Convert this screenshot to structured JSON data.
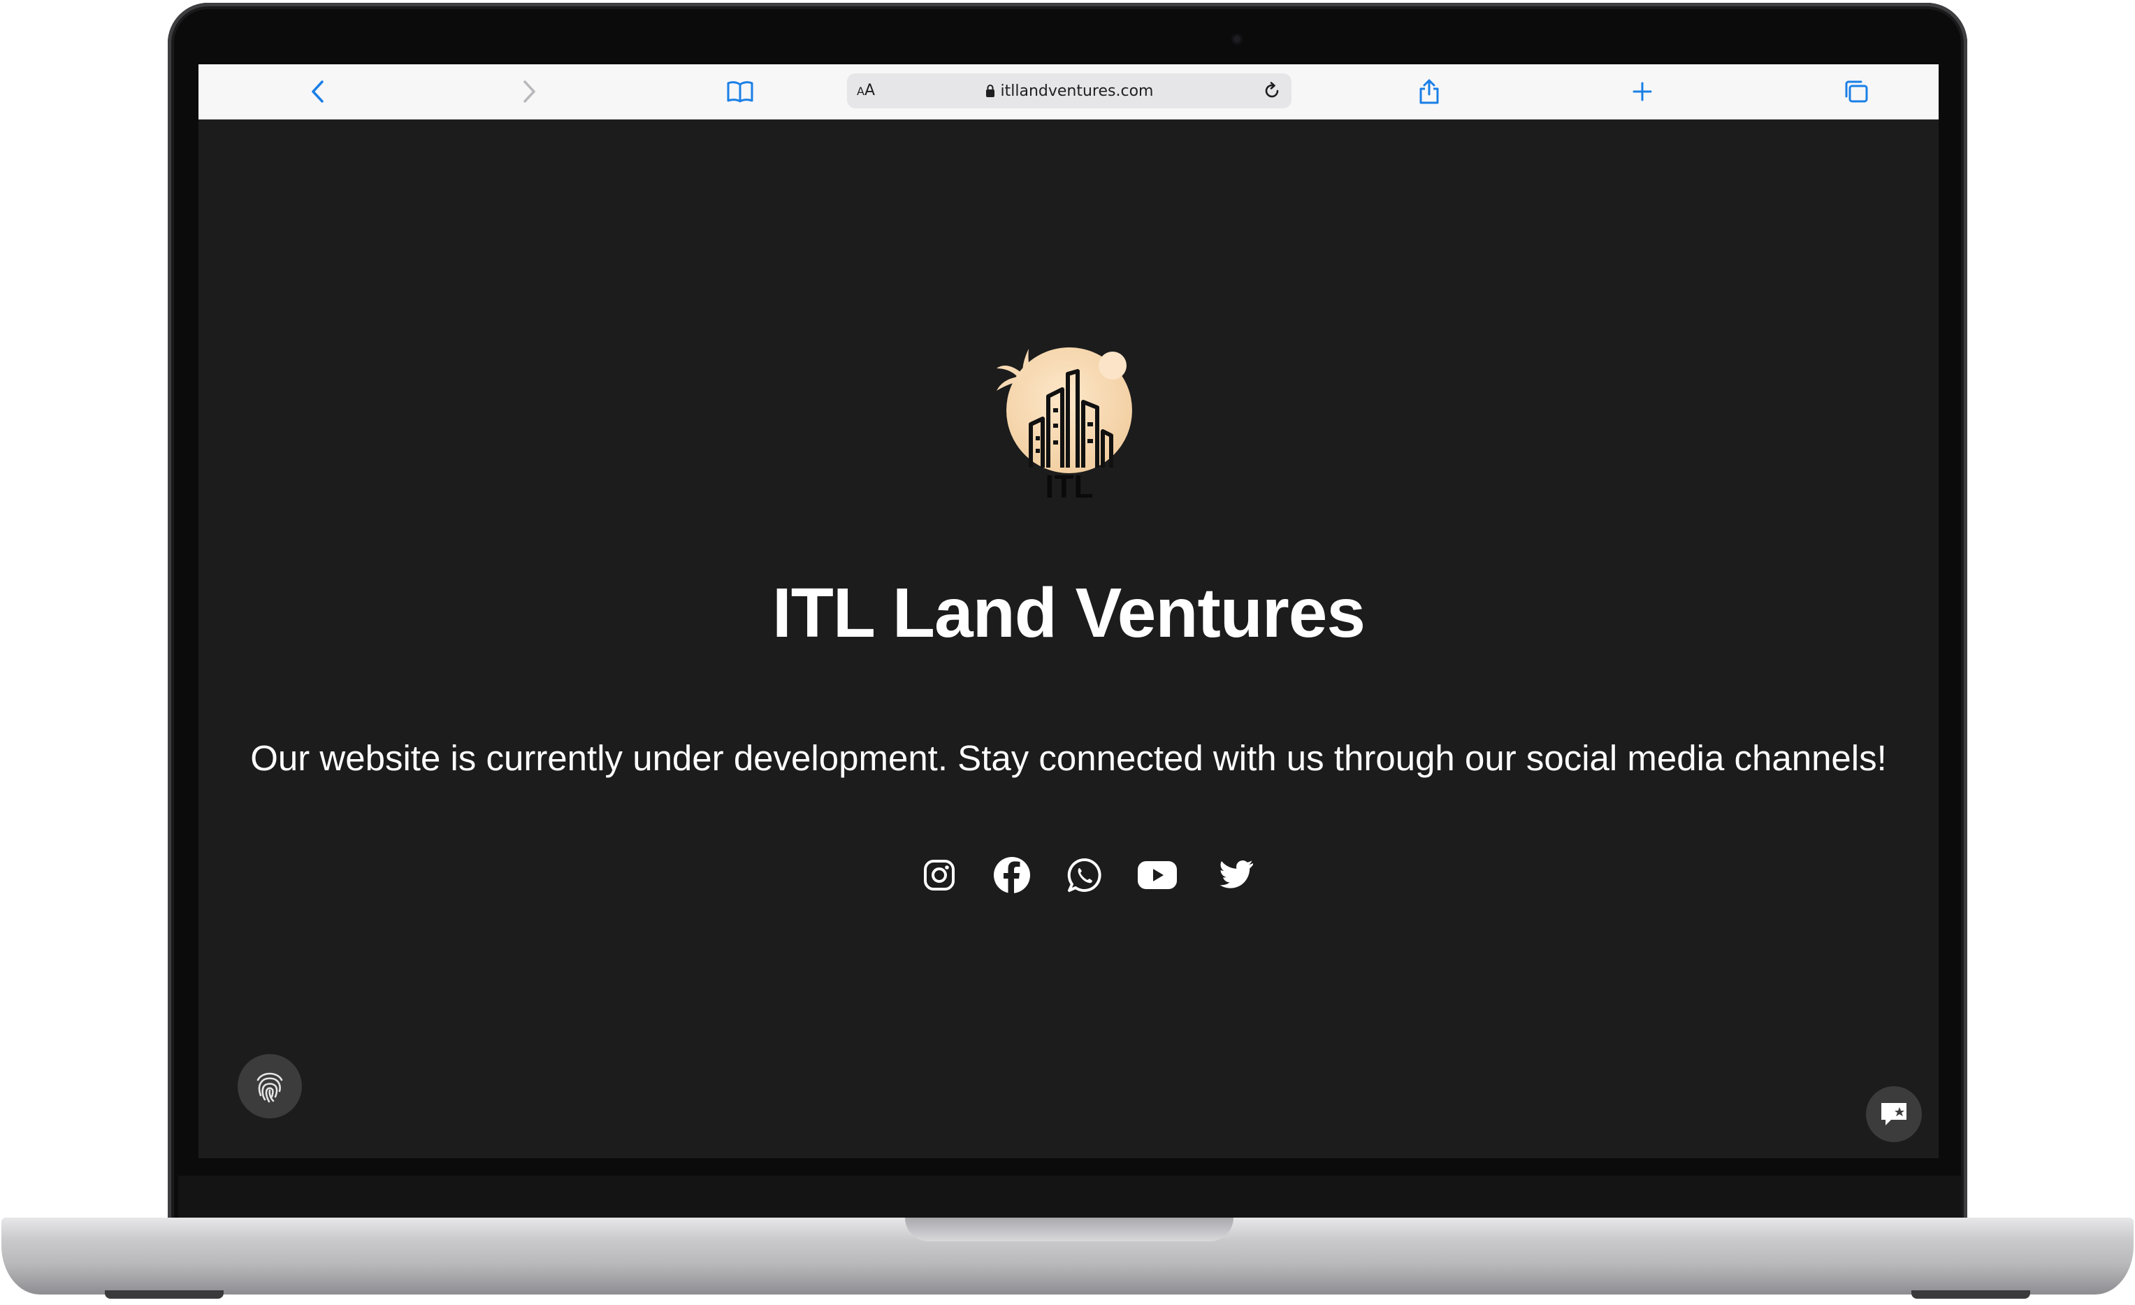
{
  "browser": {
    "text_size_label": "AA",
    "url": "itllandventures.com",
    "accent_color": "#1a7fe6"
  },
  "page": {
    "logo_text": "ITL",
    "title": "ITL Land Ventures",
    "subtitle": "Our website is currently under development. Stay connected with us through our social media channels!",
    "background_color": "#1c1c1c",
    "socials": [
      "instagram-icon",
      "facebook-icon",
      "whatsapp-icon",
      "youtube-icon",
      "twitter-icon"
    ]
  },
  "widgets": {
    "left": "fingerprint-icon",
    "right": "chat-icon"
  }
}
